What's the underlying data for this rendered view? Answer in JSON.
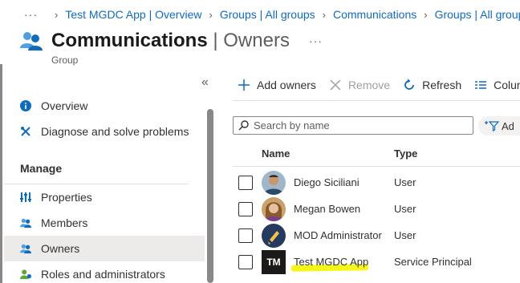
{
  "breadcrumb": {
    "items": [
      "Test MGDC App | Overview",
      "Groups | All groups",
      "Communications",
      "Groups | All groups"
    ]
  },
  "header": {
    "title_bold": "Communications",
    "title_rest": " | Owners",
    "subtitle": "Group"
  },
  "sidebar": {
    "items": [
      {
        "label": "Overview",
        "icon": "info-icon"
      },
      {
        "label": "Diagnose and solve problems",
        "icon": "wrench-icon"
      }
    ],
    "section_header": "Manage",
    "manage_items": [
      {
        "label": "Properties",
        "icon": "properties-icon"
      },
      {
        "label": "Members",
        "icon": "members-icon"
      },
      {
        "label": "Owners",
        "icon": "owners-icon",
        "active": true
      },
      {
        "label": "Roles and administrators",
        "icon": "roles-icon"
      }
    ]
  },
  "toolbar": {
    "add_owners": "Add owners",
    "remove": "Remove",
    "refresh": "Refresh",
    "columns": "Colum"
  },
  "search": {
    "placeholder": "Search by name"
  },
  "filter": {
    "label": "Ad"
  },
  "grid": {
    "columns": [
      "Name",
      "Type"
    ],
    "rows": [
      {
        "name": "Diego Siciliani",
        "type": "User",
        "avatar": "photo"
      },
      {
        "name": "Megan Bowen",
        "type": "User",
        "avatar": "photo"
      },
      {
        "name": "MOD Administrator",
        "type": "User",
        "avatar": "photo"
      },
      {
        "name": "Test MGDC App",
        "type": "Service Principal",
        "avatar": "TM"
      }
    ]
  },
  "colors": {
    "link": "#0f6cbd",
    "highlight": "#f5f500",
    "active_nav": "#edebe9"
  }
}
